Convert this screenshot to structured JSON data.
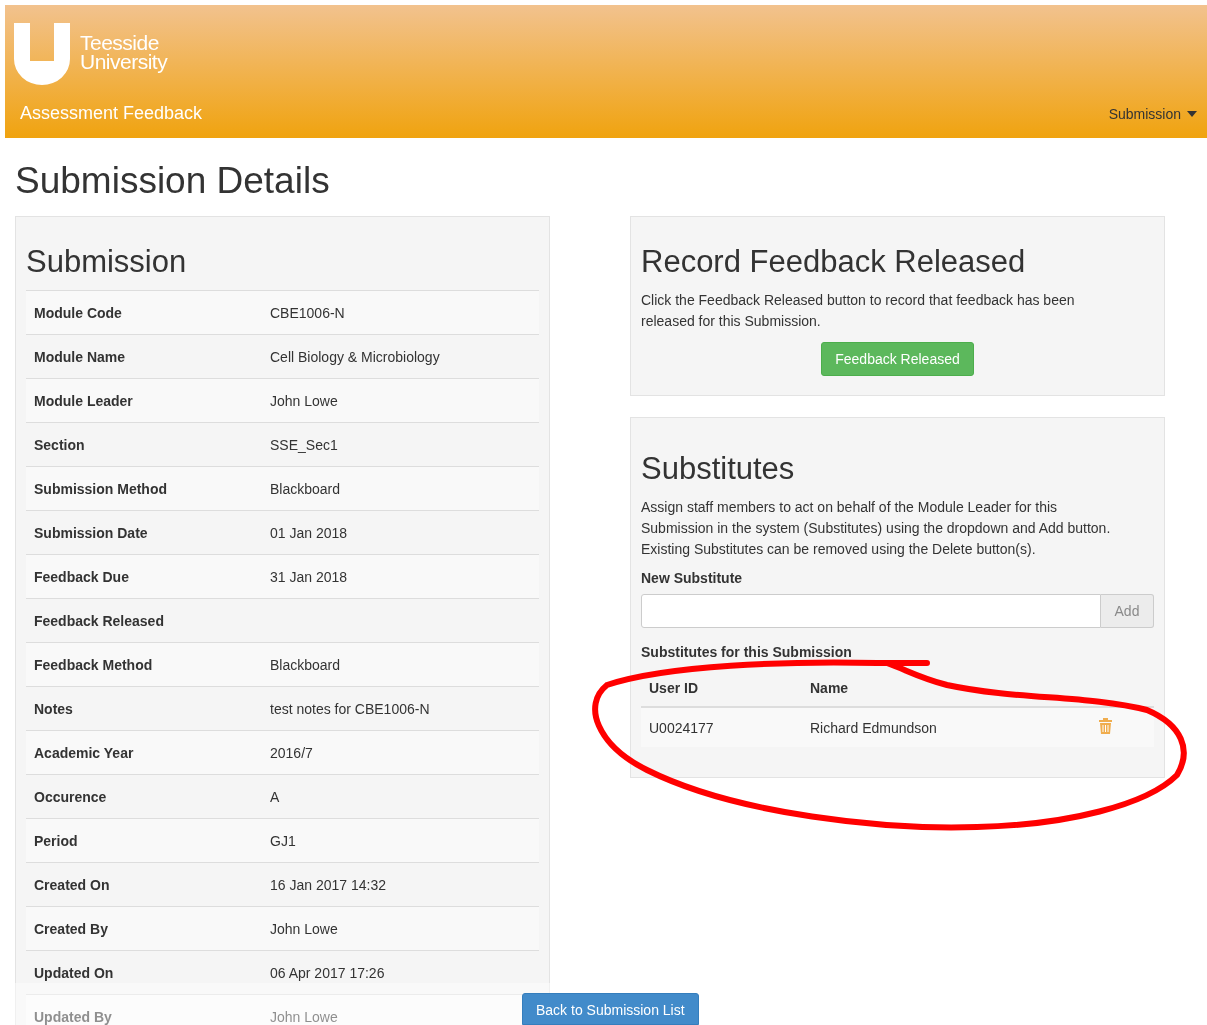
{
  "header": {
    "logo_text": [
      "Teesside",
      "University"
    ],
    "app_name": "Assessment Feedback",
    "menu": {
      "label": "Submission"
    }
  },
  "page_title": "Submission Details",
  "submission": {
    "title": "Submission",
    "rows": [
      {
        "label": "Module Code",
        "value": "CBE1006-N"
      },
      {
        "label": "Module Name",
        "value": "Cell Biology & Microbiology"
      },
      {
        "label": "Module Leader",
        "value": "John Lowe"
      },
      {
        "label": "Section",
        "value": "SSE_Sec1"
      },
      {
        "label": "Submission Method",
        "value": "Blackboard"
      },
      {
        "label": "Submission Date",
        "value": "01 Jan 2018"
      },
      {
        "label": "Feedback Due",
        "value": "31 Jan 2018"
      },
      {
        "label": "Feedback Released"
      },
      {
        "label": "Feedback Method",
        "value": "Blackboard"
      },
      {
        "label": "Notes",
        "value": "test notes for CBE1006-N"
      },
      {
        "label": "Academic Year",
        "value": "2016/7"
      },
      {
        "label": "Occurence",
        "value": "A"
      },
      {
        "label": "Period",
        "value": "GJ1"
      },
      {
        "label": "Created On",
        "value": "16 Jan 2017 14:32"
      },
      {
        "label": "Created By",
        "value": "John Lowe"
      },
      {
        "label": "Updated On",
        "value": "06 Apr 2017 17:26"
      },
      {
        "label": "Updated By",
        "value": "John Lowe"
      }
    ]
  },
  "record_feedback": {
    "title": "Record Feedback Released",
    "text": "Click the Feedback Released button to record that feedback has been released for this Submission.",
    "button": "Feedback Released"
  },
  "substitutes": {
    "title": "Substitutes",
    "text": "Assign staff members to act on behalf of the Module Leader for this Submission in the system (Substitutes) using the dropdown and Add button. Existing Substitutes can be removed using the Delete button(s).",
    "field_label": "New Substitute",
    "add_button": {
      "label": "Add",
      "disabled": true
    },
    "list_title": "Substitutes for this Submission",
    "columns": [
      "User ID",
      "Name"
    ],
    "rows": [
      {
        "user_id": "U0024177",
        "name": "Richard Edmundson"
      }
    ]
  },
  "footer": {
    "button": "Back to Submission List"
  }
}
